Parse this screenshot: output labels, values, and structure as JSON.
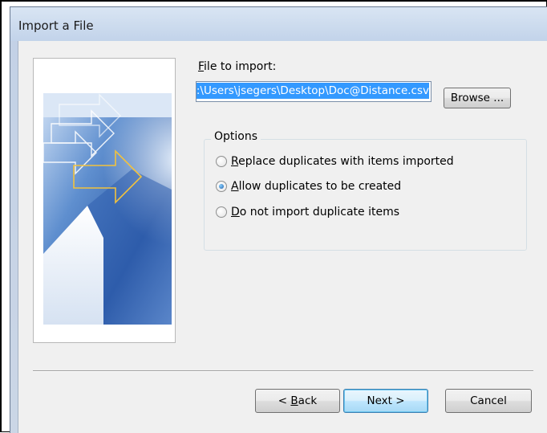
{
  "window": {
    "title": "Import a File"
  },
  "file": {
    "label_first": "F",
    "label_rest": "ile to import:",
    "value": "C:\\Users\\jsegers\\Desktop\\Doc@Distance.csv",
    "browse_label": "Browse ..."
  },
  "options": {
    "legend": "Options",
    "items": [
      {
        "key": "R",
        "rest": "eplace duplicates with items imported",
        "checked": false
      },
      {
        "key": "A",
        "rest": "llow duplicates to be created",
        "checked": true
      },
      {
        "key": "D",
        "rest": "o not import duplicate items",
        "checked": false
      }
    ]
  },
  "buttons": {
    "back_prefix": "< ",
    "back_key": "B",
    "back_rest": "ack",
    "next": "Next >",
    "cancel": "Cancel"
  }
}
